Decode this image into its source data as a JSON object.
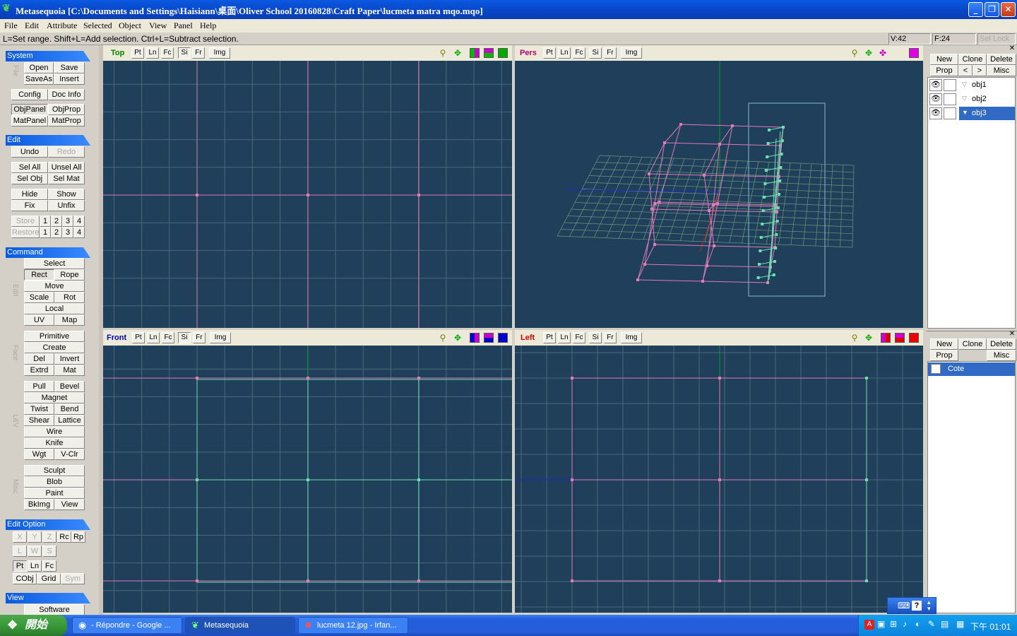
{
  "window": {
    "title": "Metasequoia [C:\\Documents and Settings\\Haisiann\\桌面\\Oliver School 20160828\\Craft Paper\\lucmeta matra mqo.mqo]",
    "app_icon": "metasequoia-leaf-icon",
    "controls": [
      "_",
      "❐",
      "✕"
    ]
  },
  "menu": [
    "File",
    "Edit",
    "Attribute",
    "Selected",
    "Object",
    "View",
    "Panel",
    "Help"
  ],
  "status": {
    "message": "L=Set range.  Shift+L=Add selection.  Ctrl+L=Subtract selection.",
    "vertices": "V:42",
    "faces": "F:24",
    "sel_lock": "Sel Lock"
  },
  "left": {
    "system": {
      "title": "System",
      "file_label": "File",
      "buttons": [
        "Open",
        "Save",
        "SaveAs",
        "Insert",
        "Config",
        "Doc Info",
        "ObjPanel",
        "ObjProp",
        "MatPanel",
        "MatProp"
      ]
    },
    "edit": {
      "title": "Edit",
      "buttons": [
        "Undo",
        "Redo",
        "Sel All",
        "Unsel All",
        "Sel Obj",
        "Sel Mat",
        "Hide",
        "Show",
        "Fix",
        "Unfix",
        "Store",
        "1",
        "2",
        "3",
        "4",
        "Restore",
        "1",
        "2",
        "3",
        "4"
      ]
    },
    "command": {
      "title": "Command",
      "edit_label": "Edit",
      "face_label": "Face",
      "lv_label": "L&V",
      "misc_label": "Misc",
      "edit_buttons": [
        "Select",
        "Rect",
        "Rope",
        "Move",
        "Scale",
        "Rot",
        "Local",
        "UV",
        "Map"
      ],
      "face_buttons": [
        "Primitive",
        "Create",
        "Del",
        "Invert",
        "Extrd",
        "Mat"
      ],
      "lv_buttons": [
        "Pull",
        "Bevel",
        "Magnet",
        "Twist",
        "Bend",
        "Shear",
        "Lattice",
        "Wire",
        "Knife",
        "Wgt",
        "V-Clr"
      ],
      "misc_buttons": [
        "Sculpt",
        "Blob",
        "Paint",
        "BkImg",
        "View"
      ]
    },
    "edit_option": {
      "title": "Edit Option",
      "buttons": [
        "X",
        "Y",
        "Z",
        "Rc",
        "Rp",
        "L",
        "W",
        "S",
        "Pt",
        "Ln",
        "Fc",
        "CObj",
        "Grid",
        "Sym"
      ]
    },
    "view": {
      "title": "View",
      "software": "Software"
    }
  },
  "viewports": [
    {
      "name": "Top",
      "color": "#008000",
      "tools": [
        "Pt",
        "Ln",
        "Fc",
        "Si",
        "Fr",
        "Img"
      ]
    },
    {
      "name": "Pers",
      "color": "#b0006a",
      "tools": [
        "Pt",
        "Ln",
        "Fc",
        "Si",
        "Fr",
        "Img"
      ]
    },
    {
      "name": "Front",
      "color": "#0000c0",
      "tools": [
        "Pt",
        "Ln",
        "Fc",
        "Si",
        "Fr",
        "Img"
      ]
    },
    {
      "name": "Left",
      "color": "#d00000",
      "tools": [
        "Pt",
        "Ln",
        "Fc",
        "Si",
        "Fr",
        "Img"
      ]
    }
  ],
  "objects_panel": {
    "buttons": [
      "New",
      "Clone",
      "Delete",
      "Prop",
      "<",
      ">",
      "Misc"
    ],
    "objects": [
      {
        "name": "obj1",
        "selected": false
      },
      {
        "name": "obj2",
        "selected": false
      },
      {
        "name": "obj3",
        "selected": true
      }
    ]
  },
  "materials_panel": {
    "buttons": [
      "New",
      "Clone",
      "Delete",
      "Prop",
      "Misc"
    ],
    "materials": [
      {
        "name": "Cote",
        "selected": true
      }
    ]
  },
  "taskbar": {
    "start": "開始",
    "tasks": [
      {
        "label": "- Répondre - Google ...",
        "icon": "chrome-icon",
        "active": false
      },
      {
        "label": "Metasequoia",
        "icon": "metasequoia-leaf-icon",
        "active": true
      },
      {
        "label": "lucmeta 12.jpg - Irfan...",
        "icon": "irfanview-icon",
        "active": false
      }
    ],
    "clock": "下午 01:01"
  }
}
